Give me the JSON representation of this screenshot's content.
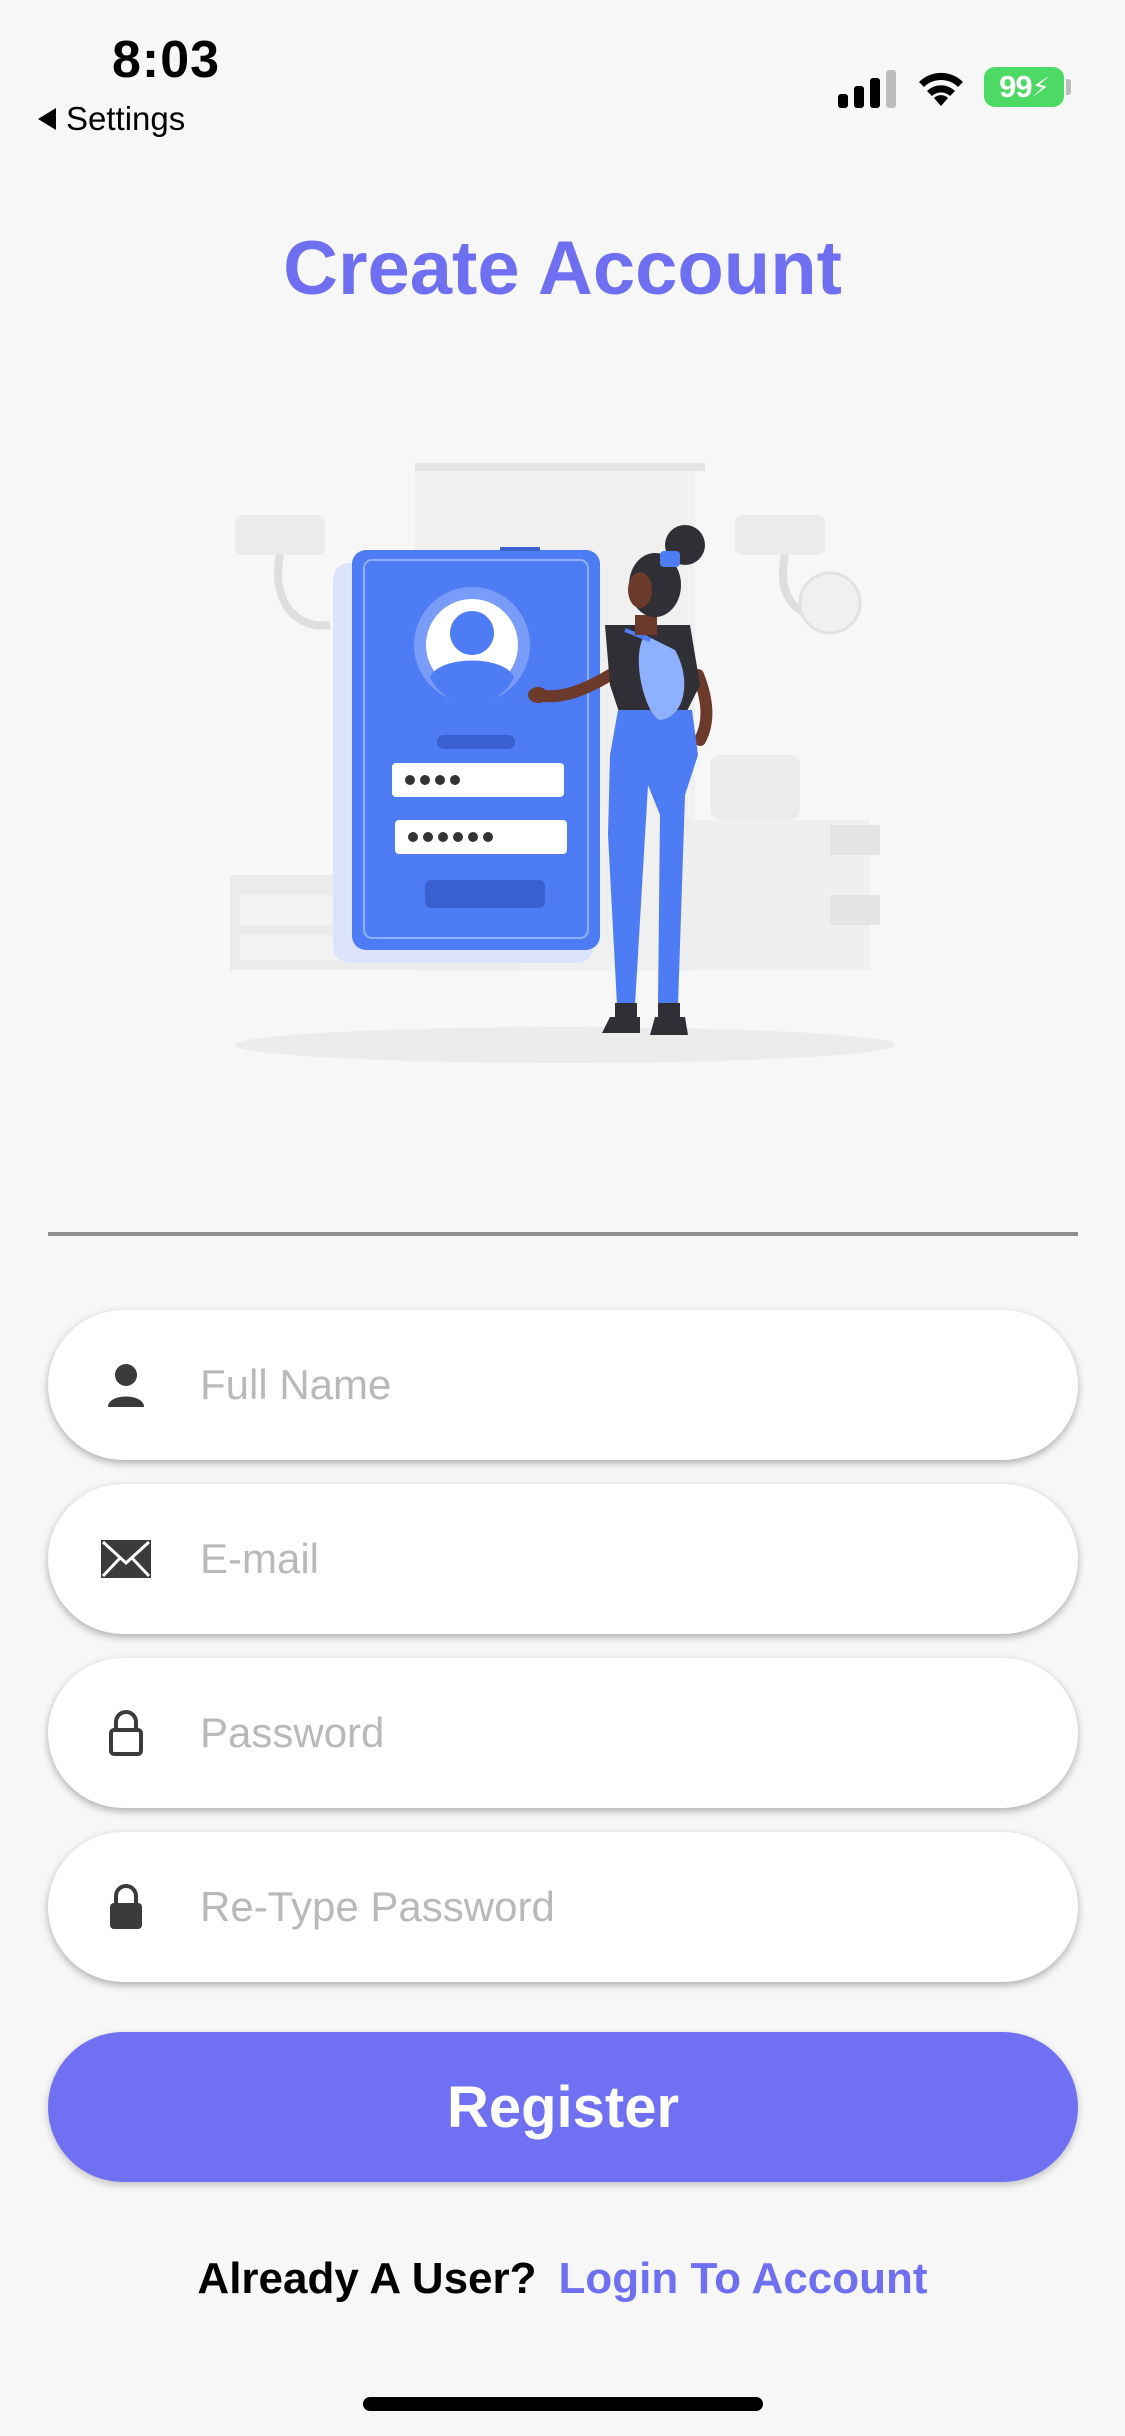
{
  "status_bar": {
    "time": "8:03",
    "back_label": "Settings",
    "battery": "99"
  },
  "title": "Create Account",
  "form": {
    "full_name_placeholder": "Full Name",
    "email_placeholder": "E-mail",
    "password_placeholder": "Password",
    "retype_password_placeholder": "Re-Type Password",
    "register_label": "Register"
  },
  "footer": {
    "question": "Already A User?",
    "login_link": "Login To Account"
  },
  "icons": {
    "full_name": "person-icon",
    "email": "envelope-icon",
    "password": "lock-open-icon",
    "retype_password": "lock-icon"
  },
  "colors": {
    "accent": "#6f6ff2",
    "button": "#7070f3",
    "background": "#f7f7f7",
    "illustration_blue": "#4d7cf5",
    "battery": "#4cd964"
  }
}
